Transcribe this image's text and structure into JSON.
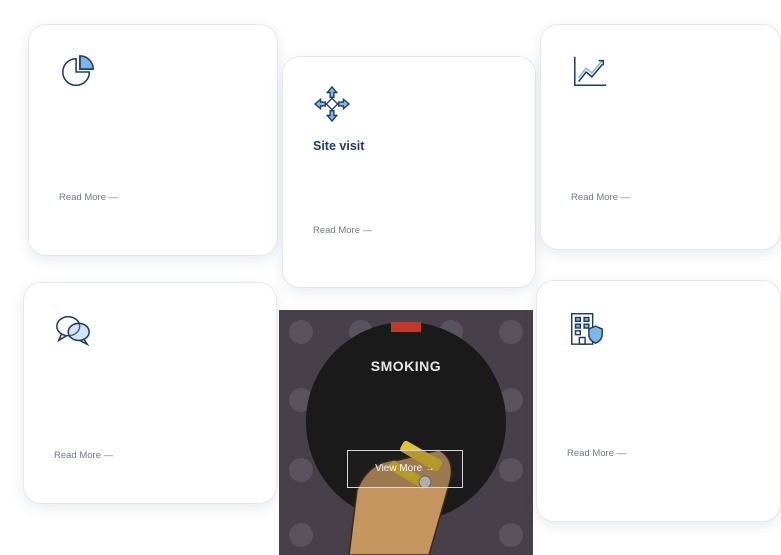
{
  "section": {
    "title": ""
  },
  "cards": [
    {
      "title": "",
      "desc": "",
      "link": "Read More —",
      "icon": "pie-chart-icon"
    },
    {
      "title": "Site visit",
      "desc": "",
      "link": "Read More —",
      "icon": "compass-arrows-icon"
    },
    {
      "title": "",
      "desc": "",
      "link": "Read More —",
      "icon": "line-chart-icon"
    },
    {
      "title": "",
      "desc": "",
      "link": "Read More —",
      "icon": "speech-bubbles-icon"
    },
    {
      "title": "",
      "desc": "",
      "link": "Read More —",
      "icon": "building-shield-icon"
    }
  ],
  "promo": {
    "headline": "SMOKING",
    "subtitle": "",
    "button": "View More →"
  },
  "colors": {
    "heading": "#1e3a5f",
    "icon_stroke": "#1e3a5f",
    "icon_fill": "#7fb6e8",
    "promo_bg": "#47404a",
    "promo_ring": "#1a1a1a",
    "promo_accent": "#e6c12a"
  }
}
